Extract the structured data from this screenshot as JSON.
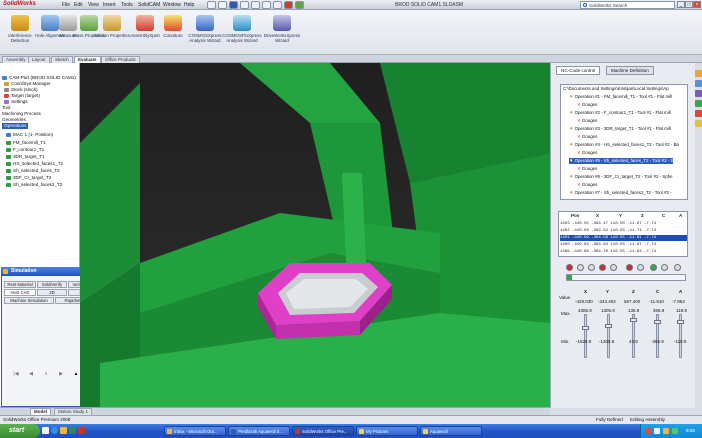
{
  "app": {
    "logo": "SolidWorks",
    "doc_title": "BROD SOLID CAM1.SLDASM",
    "menus": [
      "File",
      "Edit",
      "View",
      "Insert",
      "Tools",
      "SolidCAM",
      "Window",
      "Help"
    ],
    "search_placeholder": "SolidWorks Search"
  },
  "toolbar": {
    "buttons": [
      {
        "label": "Interference Detection",
        "icon": "interference-icon"
      },
      {
        "label": "Hole Alignment",
        "icon": "hole-icon"
      },
      {
        "label": "Measure",
        "icon": "measure-icon"
      },
      {
        "label": "Mass Properties",
        "icon": "mass-icon"
      },
      {
        "label": "Section Properties",
        "icon": "section-icon"
      },
      {
        "label": "AssemblyXpert",
        "icon": "xpert-icon"
      },
      {
        "label": "Curvature",
        "icon": "curvature-icon"
      },
      {
        "label": "COSMOSXpress Analysis Wizard",
        "icon": "cosmos-icon"
      },
      {
        "label": "COSMOSFloXpress Analysis Wizard",
        "icon": "flo-icon"
      },
      {
        "label": "DriveWorksXpress Wizard",
        "icon": "driveworks-icon"
      }
    ]
  },
  "cmd_tabs": [
    "Assembly",
    "Layout",
    "Sketch",
    "Evaluate",
    "Office Products"
  ],
  "cmd_tab_active": "Evaluate",
  "left_tree": {
    "items": [
      "CAM-Part (BROD SOLID CAM1)",
      "CoordSys Manager",
      "Stock (stock)",
      "Target (target)",
      "Settings",
      "Tool",
      "Machining Process",
      "Geometries",
      "Operations",
      "MAC 1 (1- Position)",
      "FM_facemill_T1",
      "F_contour1_T1",
      "3DR_target_T1",
      "HS_selected_faces1_T2",
      "Sh_selected_faces_T2",
      "3DF_Cr_target_T2",
      "Sh_selected_faces2_T2"
    ],
    "selected": "Operations"
  },
  "simulation": {
    "title": "Simulation",
    "tabs_row1": [
      "Rest Material",
      "SolidVerify",
      "VerifyPlus"
    ],
    "tabs_row2": [
      "Host CAD",
      "2D",
      "3D"
    ],
    "tabs_row3": [
      "Machine Simulation",
      "RapidVerify"
    ]
  },
  "right_panel": {
    "tabs": [
      "NC-Code control",
      "Machine Definition"
    ],
    "path": "C:\\Documents and Settings\\Kristijan\\Local Settings\\Ap",
    "operations": [
      {
        "op": "Operation #1 - FM_facemill_T1 - Tool #1 - Flat mill",
        "sub": "Gouges"
      },
      {
        "op": "Operation #2 - F_contour1_T1 - Tool #1 - Flat mill",
        "sub": "Gouges"
      },
      {
        "op": "Operation #3 - 3DR_target_T1 - Tool #1 - Flat mill",
        "sub": "Gouges"
      },
      {
        "op": "Operation #4 - HS_selected_faces1_T2 - Tool #2 - Ba",
        "sub": "Gouges"
      },
      {
        "op": "Operation #5 - Sh_selected_faces_T2 - Tool #2 - S",
        "sub": "Gouges"
      },
      {
        "op": "Operation #6 - 3DF_Cr_target_T2 - Tool #2 - Sphe",
        "sub": "Gouges"
      },
      {
        "op": "Operation #7 - Sh_selected_faces2_T2 - Tool #2 -",
        "sub": ""
      }
    ],
    "pos_headers": [
      "Pos",
      "X",
      "Y",
      "Z",
      "C",
      "A"
    ],
    "pos_rows": [
      "1403  -440.55  -364.47  110.55  -11.67  -7.74",
      "1402  -440.56  -364.52  110.55  -11.74  -7.74",
      "1401  -440.59  -364.58  110.55  -11.81  -7.74",
      "1400  -440.63  -364.64  110.55  -11.87  -7.74",
      "1399  -440.68  -364.70  110.55  -11.92  -7.74",
      "1398  -440.73  -364.76  110.55  -11.98  -7.74"
    ],
    "selected_row": 2,
    "axes": [
      "X",
      "Y",
      "Z",
      "C",
      "A"
    ],
    "value_label": "Value",
    "values": [
      "-429.030",
      "-343.402",
      "567.400",
      "-11.810",
      "-7.863"
    ],
    "max_label": "Max.",
    "max_values": [
      "4385.9",
      "1305.9",
      "135.9",
      "365.9",
      "118.9"
    ],
    "min_label": "Min.",
    "min_values": [
      "-1525.9",
      "-1305.9",
      "43.9",
      "-365.9",
      "-118.9"
    ],
    "progress": 0.04
  },
  "model_tabs": [
    "Model",
    "Motion Study 1"
  ],
  "status": {
    "left": "SolidWorks Office Premium 2008",
    "defined": "Fully Defined",
    "mode": "Editing Assembly"
  },
  "taskbar": {
    "start": "start",
    "tasks": [
      "Inbox - Microsoft Out...",
      "Predlozak Aquaestil d...",
      "SolidWorks Office Pre...",
      "My Pictures",
      "Aquaestil"
    ],
    "clock": "9:55"
  },
  "colors": {
    "machine_green": "#1f9a3a",
    "stock_pink": "#e040c8",
    "selection_blue": "#2b5fb8"
  }
}
